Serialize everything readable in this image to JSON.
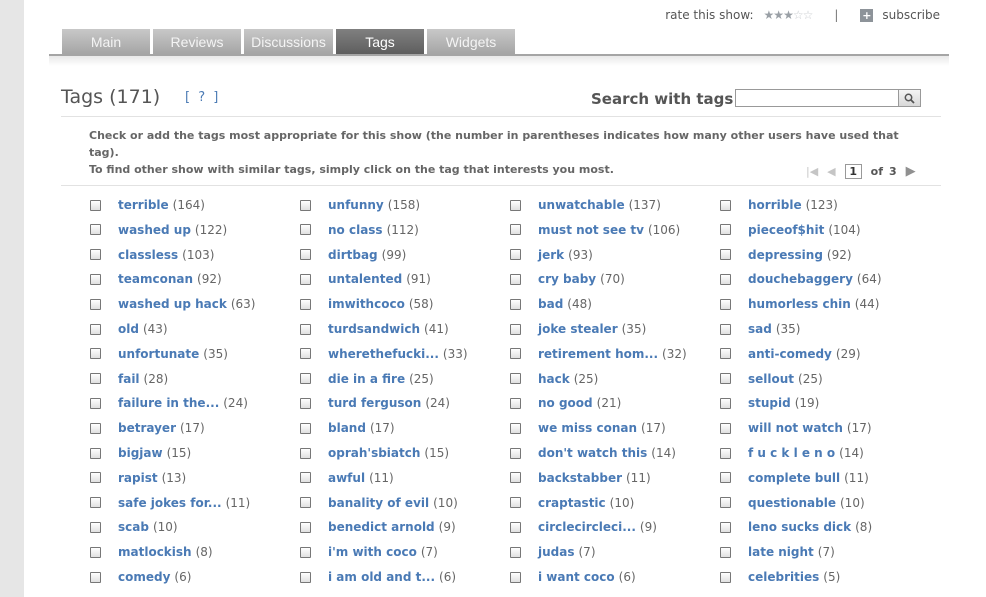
{
  "topbar": {
    "rate_label": "rate this show:",
    "rating_stars": 2.5,
    "rating_max": 5,
    "separator": "|",
    "subscribe_label": "subscribe"
  },
  "tabs": [
    {
      "label": "Main",
      "active": false
    },
    {
      "label": "Reviews",
      "active": false
    },
    {
      "label": "Discussions",
      "active": false
    },
    {
      "label": "Tags",
      "active": true
    },
    {
      "label": "Widgets",
      "active": false
    }
  ],
  "header": {
    "title": "Tags (171)",
    "help": "[ ? ]",
    "search_label": "Search with tags:",
    "search_value": ""
  },
  "description": {
    "line1": "Check or add the tags most appropriate for this show (the number in parentheses indicates how many other users have used that tag).",
    "line2": "To find other show with similar tags, simply click on the tag that interests you most."
  },
  "pager": {
    "current": "1",
    "of_label": "of",
    "total": "3"
  },
  "tags": [
    [
      {
        "name": "terrible",
        "count": "(164)"
      },
      {
        "name": "washed up",
        "count": "(122)"
      },
      {
        "name": "classless",
        "count": "(103)"
      },
      {
        "name": "teamconan",
        "count": "(92)"
      },
      {
        "name": "washed up hack",
        "count": "(63)"
      },
      {
        "name": "old",
        "count": "(43)"
      },
      {
        "name": "unfortunate",
        "count": "(35)"
      },
      {
        "name": "fail",
        "count": "(28)"
      },
      {
        "name": "failure in the...",
        "count": "(24)"
      },
      {
        "name": "betrayer",
        "count": "(17)"
      },
      {
        "name": "bigjaw",
        "count": "(15)"
      },
      {
        "name": "rapist",
        "count": "(13)"
      },
      {
        "name": "safe jokes for...",
        "count": "(11)"
      },
      {
        "name": "scab",
        "count": "(10)"
      },
      {
        "name": "matlockish",
        "count": "(8)"
      },
      {
        "name": "comedy",
        "count": "(6)"
      }
    ],
    [
      {
        "name": "unfunny",
        "count": "(158)"
      },
      {
        "name": "no class",
        "count": "(112)"
      },
      {
        "name": "dirtbag",
        "count": "(99)"
      },
      {
        "name": "untalented",
        "count": "(91)"
      },
      {
        "name": "imwithcoco",
        "count": "(58)"
      },
      {
        "name": "turdsandwich",
        "count": "(41)"
      },
      {
        "name": "wherethefucki...",
        "count": "(33)"
      },
      {
        "name": "die in a fire",
        "count": "(25)"
      },
      {
        "name": "turd ferguson",
        "count": "(24)"
      },
      {
        "name": "bland",
        "count": "(17)"
      },
      {
        "name": "oprah'sbiatch",
        "count": "(15)"
      },
      {
        "name": "awful",
        "count": "(11)"
      },
      {
        "name": "banality of evil",
        "count": "(10)"
      },
      {
        "name": "benedict arnold",
        "count": "(9)"
      },
      {
        "name": "i'm with coco",
        "count": "(7)"
      },
      {
        "name": "i am old and t...",
        "count": "(6)"
      }
    ],
    [
      {
        "name": "unwatchable",
        "count": "(137)"
      },
      {
        "name": "must not see tv",
        "count": "(106)"
      },
      {
        "name": "jerk",
        "count": "(93)"
      },
      {
        "name": "cry baby",
        "count": "(70)"
      },
      {
        "name": "bad",
        "count": "(48)"
      },
      {
        "name": "joke stealer",
        "count": "(35)"
      },
      {
        "name": "retirement hom...",
        "count": "(32)"
      },
      {
        "name": "hack",
        "count": "(25)"
      },
      {
        "name": "no good",
        "count": "(21)"
      },
      {
        "name": "we miss conan",
        "count": "(17)"
      },
      {
        "name": "don't watch this",
        "count": "(14)"
      },
      {
        "name": "backstabber",
        "count": "(11)"
      },
      {
        "name": "craptastic",
        "count": "(10)"
      },
      {
        "name": "circlecircleci...",
        "count": "(9)"
      },
      {
        "name": "judas",
        "count": "(7)"
      },
      {
        "name": "i want coco",
        "count": "(6)"
      }
    ],
    [
      {
        "name": "horrible",
        "count": "(123)"
      },
      {
        "name": "pieceof$hit",
        "count": "(104)"
      },
      {
        "name": "depressing",
        "count": "(92)"
      },
      {
        "name": "douchebaggery",
        "count": "(64)"
      },
      {
        "name": "humorless chin",
        "count": "(44)"
      },
      {
        "name": "sad",
        "count": "(35)"
      },
      {
        "name": "anti-comedy",
        "count": "(29)"
      },
      {
        "name": "sellout",
        "count": "(25)"
      },
      {
        "name": "stupid",
        "count": "(19)"
      },
      {
        "name": "will not watch",
        "count": "(17)"
      },
      {
        "name": "f u c k l e n o",
        "count": "(14)"
      },
      {
        "name": "complete bull",
        "count": "(11)"
      },
      {
        "name": "questionable",
        "count": "(10)"
      },
      {
        "name": "leno sucks dick",
        "count": "(8)"
      },
      {
        "name": "late night",
        "count": "(7)"
      },
      {
        "name": "celebrities",
        "count": "(5)"
      }
    ]
  ]
}
